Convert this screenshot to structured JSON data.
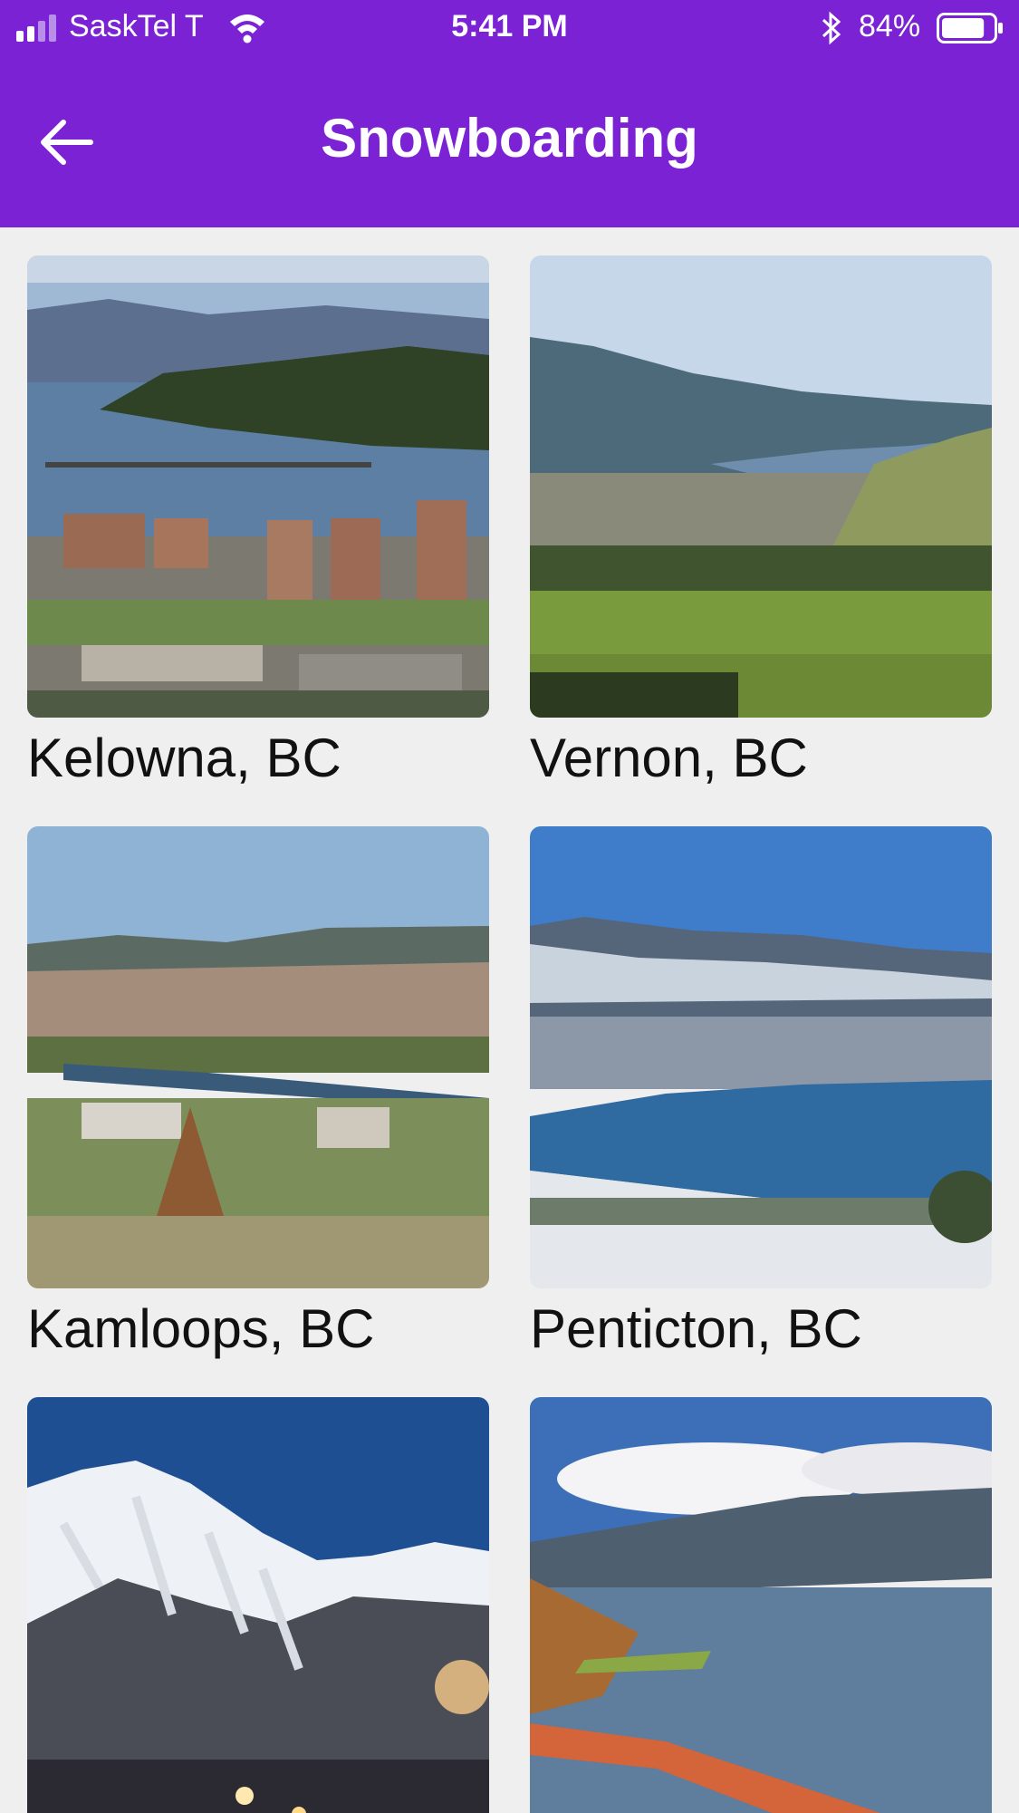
{
  "status_bar": {
    "carrier": "SaskTel T",
    "time": "5:41 PM",
    "battery": "84%",
    "battery_level": 0.84
  },
  "header": {
    "title": "Snowboarding",
    "background": "#7b22d4"
  },
  "tiles": [
    {
      "label": "Kelowna, BC",
      "image": "kelowna-photo"
    },
    {
      "label": "Vernon, BC",
      "image": "vernon-photo"
    },
    {
      "label": "Kamloops, BC",
      "image": "kamloops-photo"
    },
    {
      "label": "Penticton, BC",
      "image": "penticton-photo"
    },
    {
      "label": "",
      "image": "ski-hill-photo"
    },
    {
      "label": "",
      "image": "nelson-bridge-photo"
    }
  ]
}
